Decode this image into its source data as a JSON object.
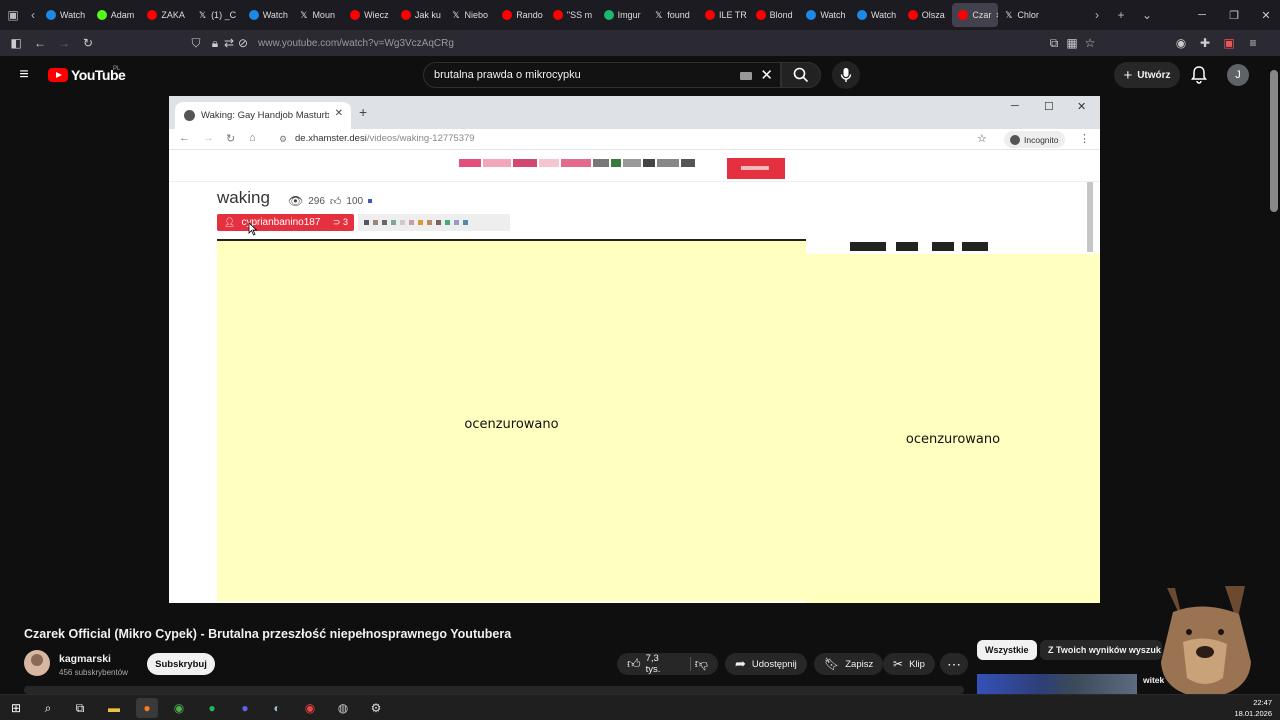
{
  "browser": {
    "tabs": [
      {
        "label": "Watch",
        "icon": "circle-play",
        "color": "#1e88e5"
      },
      {
        "label": "Adam",
        "icon": "k-logo",
        "color": "#53fc18"
      },
      {
        "label": "ZAKA",
        "icon": "youtube",
        "color": "#ff0000"
      },
      {
        "label": "(1) _C",
        "icon": "x",
        "color": "#ffffff"
      },
      {
        "label": "Watch",
        "icon": "circle-play",
        "color": "#1e88e5"
      },
      {
        "label": "Moun",
        "icon": "x",
        "color": "#ffffff"
      },
      {
        "label": "Wiecz",
        "icon": "youtube",
        "color": "#ff0000"
      },
      {
        "label": "Jak ku",
        "icon": "youtube",
        "color": "#ff0000"
      },
      {
        "label": "Niebo",
        "icon": "x",
        "color": "#ffffff"
      },
      {
        "label": "Rando",
        "icon": "youtube",
        "color": "#ff0000"
      },
      {
        "label": "\"SS m",
        "icon": "youtube",
        "color": "#ff0000"
      },
      {
        "label": "Imgur",
        "icon": "imgur",
        "color": "#1bb76e"
      },
      {
        "label": "found",
        "icon": "x",
        "color": "#ffffff"
      },
      {
        "label": "ILE TR",
        "icon": "youtube",
        "color": "#ff0000"
      },
      {
        "label": "Blond",
        "icon": "youtube",
        "color": "#ff0000"
      },
      {
        "label": "Watch",
        "icon": "circle-play",
        "color": "#1e88e5"
      },
      {
        "label": "Watch",
        "icon": "circle-play",
        "color": "#1e88e5"
      },
      {
        "label": "Olsza",
        "icon": "youtube",
        "color": "#ff0000"
      },
      {
        "label": "Czar",
        "icon": "youtube",
        "color": "#ff0000",
        "active": true
      },
      {
        "label": "Chlor",
        "icon": "x",
        "color": "#ffffff"
      }
    ],
    "url": "www.youtube.com/watch?v=Wg3VczAqCRg"
  },
  "youtube": {
    "logo_text": "YouTube",
    "country": "PL",
    "search_query": "brutalna prawda o mikrocypku",
    "create_label": "Utwórz",
    "avatar_letter": "J",
    "accent": "#ff0000"
  },
  "video": {
    "inner_tab_title": "Waking: Gay Handjob Masturbat",
    "incognito_label": "Incognito",
    "inner_url_host": "de.xhamster.desi",
    "inner_url_path": "/videos/waking-12775379",
    "page_title": "waking",
    "views": "296",
    "likes": "100",
    "uploader": "cyprianbanino187",
    "uploader_count": "3",
    "censor_main": "ocenzurowano",
    "censor_side": "ocenzurowano",
    "highlight_color": "#ffffc0"
  },
  "below": {
    "title": "Czarek Official (Mikro Cypek) - Brutalna przeszłość niepełnosprawnego Youtubera",
    "channel": "kagmarski",
    "subscribers": "456 subskrybentów",
    "subscribe_label": "Subskrybuj",
    "like_count": "7,3 tys.",
    "share_label": "Udostępnij",
    "save_label": "Zapisz",
    "clip_label": "Klip",
    "chip_all": "Wszystkie",
    "chip_yours": "Z Twoich wyników wyszuk",
    "side_video_text": "witek"
  },
  "taskbar": {
    "time": "22:47",
    "date": "18.01.2026"
  }
}
